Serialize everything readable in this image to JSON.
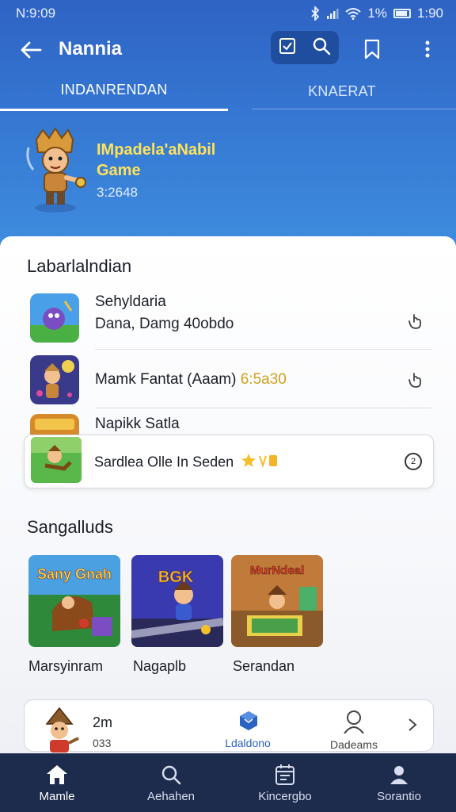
{
  "status_bar": {
    "left_text": "N:9:09",
    "battery_pct": "1%",
    "time": "1:90"
  },
  "app_bar": {
    "title": "Nannia",
    "icons": [
      "back-arrow-icon",
      "checkbox-icon",
      "search-icon",
      "bookmark-icon",
      "more-vert-icon"
    ]
  },
  "tabs": [
    {
      "label": "INDANRENDAN",
      "active": true
    },
    {
      "label": "KNAERAT",
      "active": false
    }
  ],
  "hero": {
    "title_line1": "IMpadela'aNabil",
    "title_line2": "Game",
    "subtitle": "3:2648"
  },
  "section1": {
    "title": "Labarlalndian",
    "items": [
      {
        "title": "Sehyldaria",
        "subtitle": "Dana, Damg 40obdo",
        "action_icon": "hand-pointer-icon"
      },
      {
        "title": "Mamk Fantat (Aaam)",
        "highlight": "6:5a30",
        "action_icon": "hand-pointer-icon"
      },
      {
        "title": "Napikk Satla"
      }
    ]
  },
  "highlight_card": {
    "text": "Sardlea Olle In Seden",
    "badge_icon": "star-icon",
    "circle_text": "2"
  },
  "section2": {
    "title": "Sangalluds",
    "tiles": [
      {
        "label": "Marsyinram",
        "art_text": "Sany Gnah"
      },
      {
        "label": "Nagaplb",
        "art_text": "BGK"
      },
      {
        "label": "Serandan",
        "art_text": "MurNdeal"
      }
    ]
  },
  "mini_player": {
    "time": "2m",
    "sub": "033",
    "center_label": "Ldaldono",
    "right_label": "Dadeams"
  },
  "bottom_nav": [
    {
      "label": "Mamle",
      "icon": "home-icon",
      "active": true
    },
    {
      "label": "Aehahen",
      "icon": "search-icon",
      "active": false
    },
    {
      "label": "Kincergbo",
      "icon": "calendar-icon",
      "active": false
    },
    {
      "label": "Sorantio",
      "icon": "profile-icon",
      "active": false
    }
  ],
  "colors": {
    "header": "#3577d2",
    "accent_yellow": "#ffe25a",
    "nav_bg": "#1d2b4c",
    "link_blue": "#2a63c2"
  }
}
